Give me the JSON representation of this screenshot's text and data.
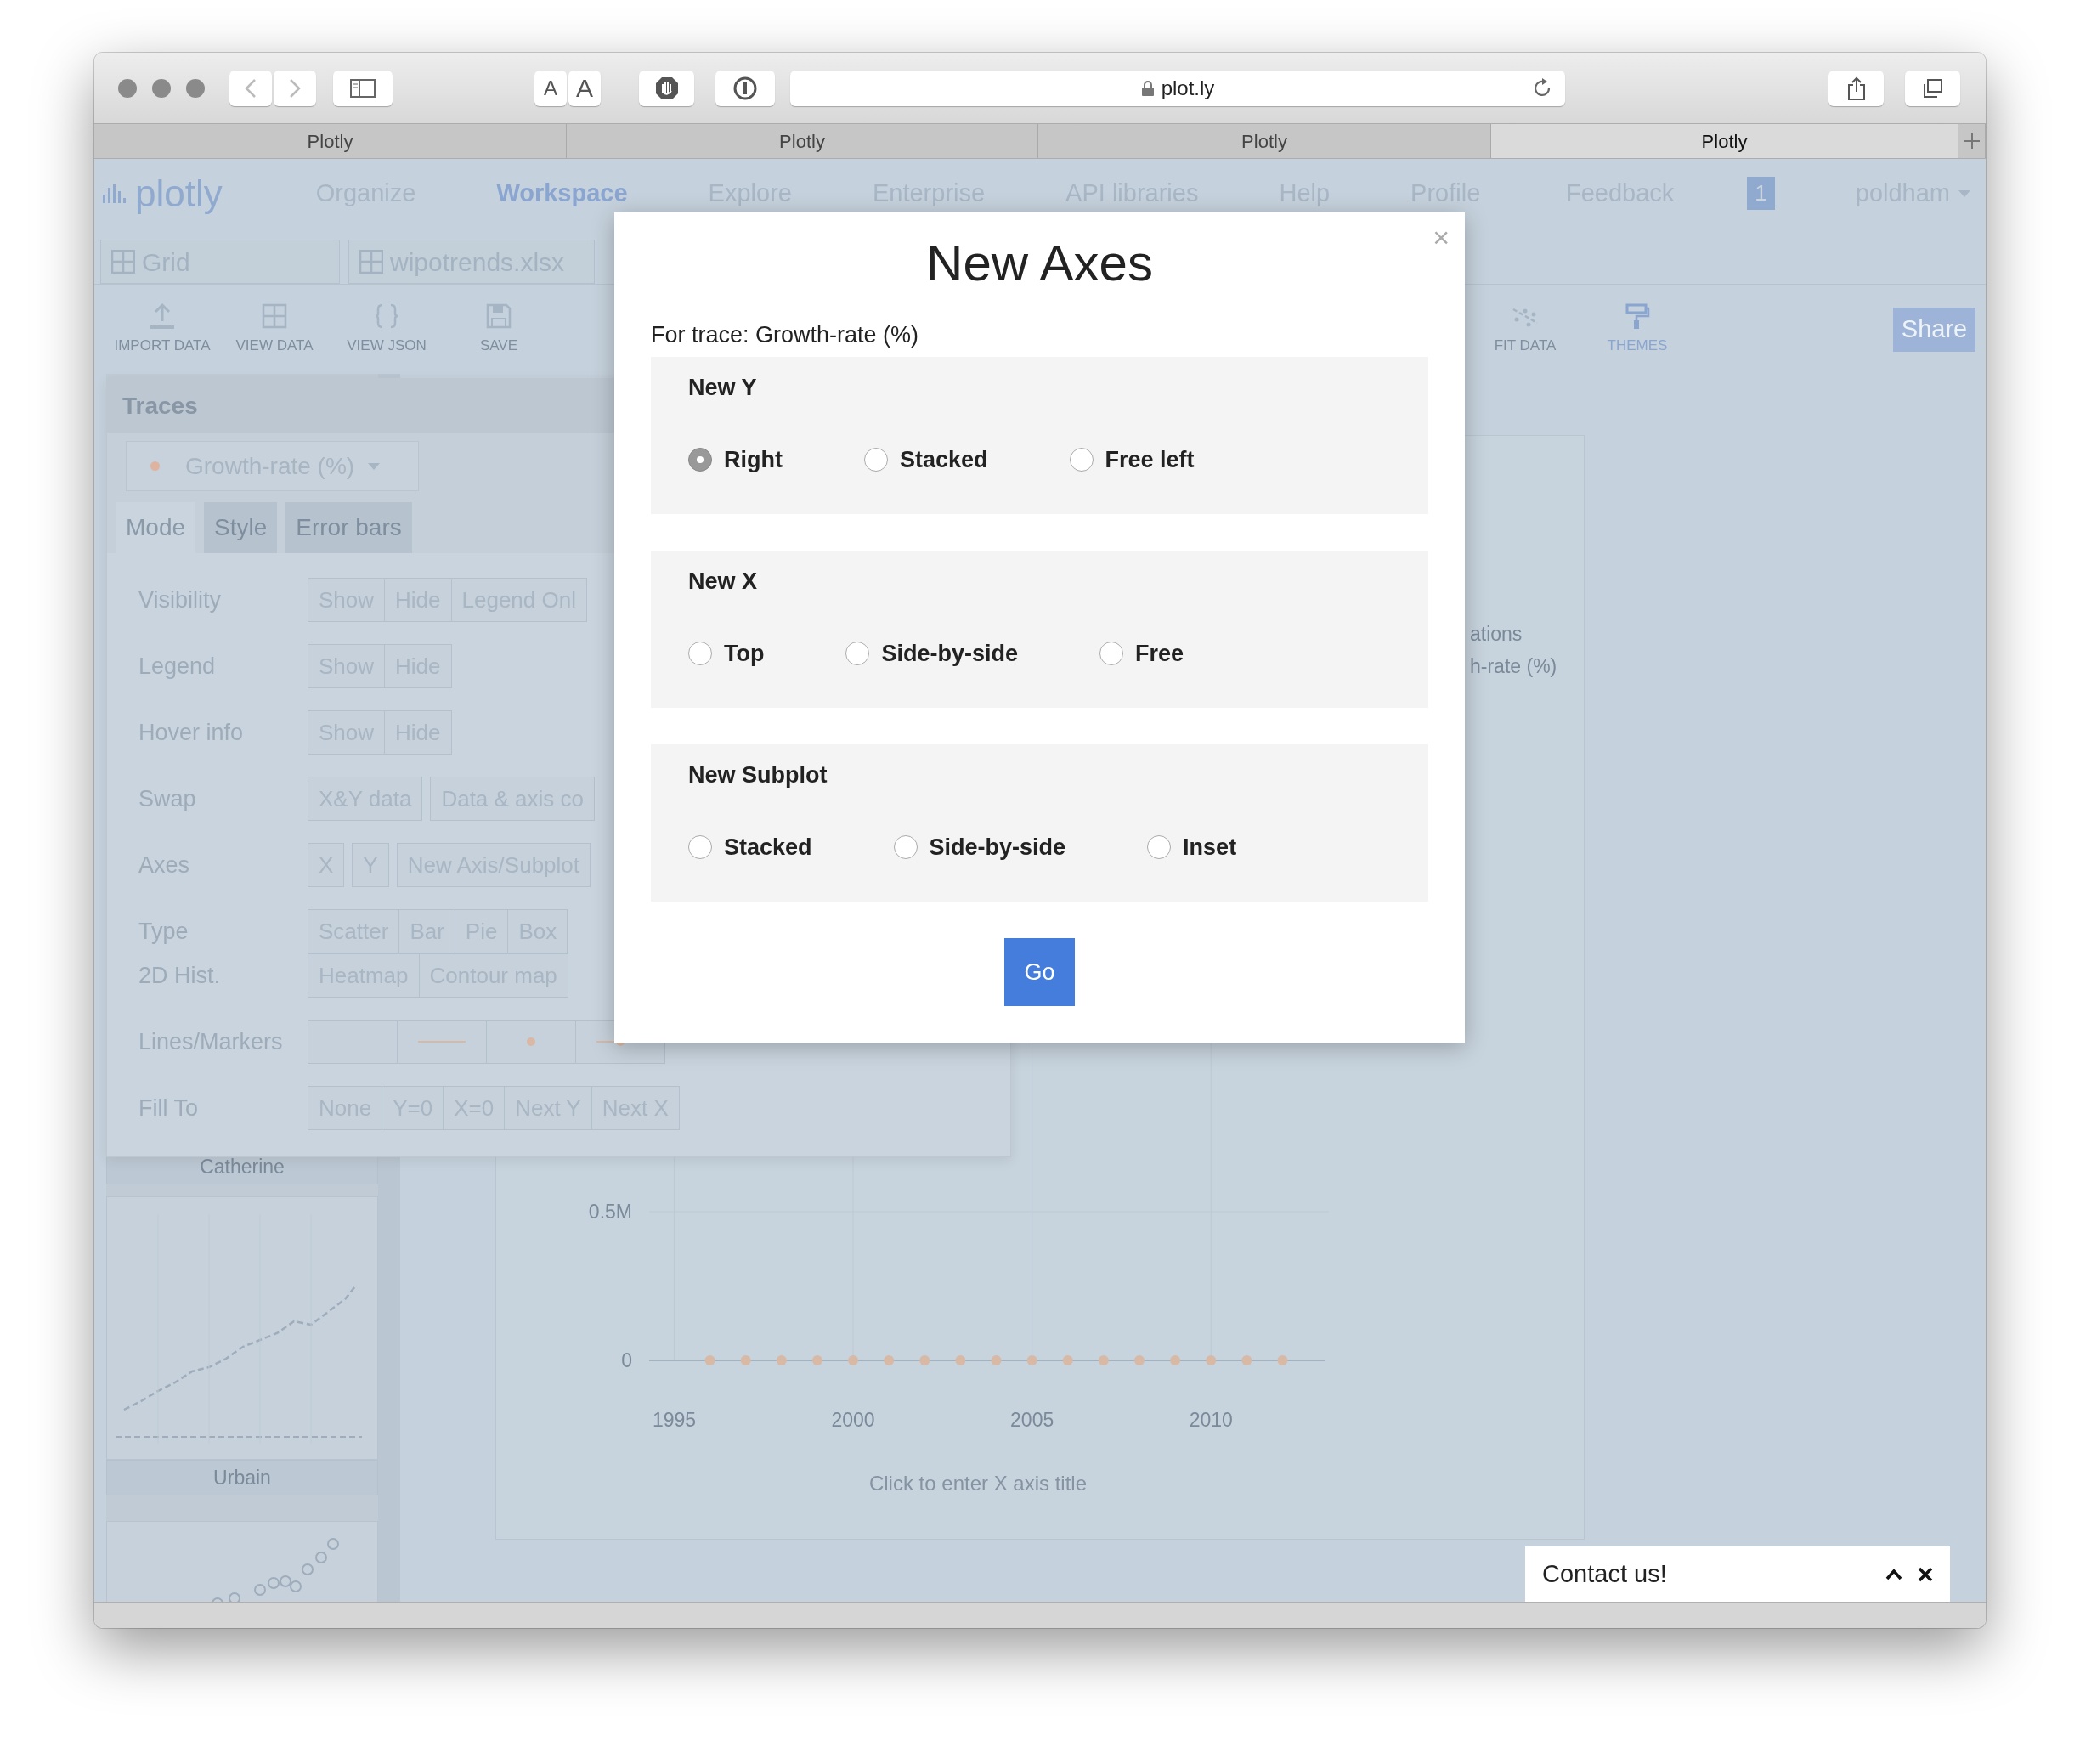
{
  "browser": {
    "text_size_buttons": [
      "A",
      "A"
    ],
    "address": "plot.ly",
    "tabs": [
      {
        "label": "Plotly",
        "selected": false
      },
      {
        "label": "Plotly",
        "selected": false
      },
      {
        "label": "Plotly",
        "selected": false
      },
      {
        "label": "Plotly",
        "selected": true
      }
    ]
  },
  "app": {
    "logo": "plotly",
    "nav": [
      {
        "label": "Organize",
        "selected": false
      },
      {
        "label": "Workspace",
        "selected": true
      },
      {
        "label": "Explore",
        "selected": false
      },
      {
        "label": "Enterprise",
        "selected": false
      },
      {
        "label": "API libraries",
        "selected": false
      },
      {
        "label": "Help",
        "selected": false
      },
      {
        "label": "Profile",
        "selected": false
      }
    ],
    "feedback": "Feedback",
    "notifications": "1",
    "user": "poldham"
  },
  "file_tabs": [
    {
      "label": "Grid"
    },
    {
      "label": "wipotrends.xlsx"
    }
  ],
  "toolbar_left": [
    {
      "label": "IMPORT DATA",
      "kind": "import",
      "selected": false
    },
    {
      "label": "VIEW DATA",
      "kind": "grid",
      "selected": false
    },
    {
      "label": "VIEW JSON",
      "kind": "json",
      "selected": false
    },
    {
      "label": "SAVE",
      "kind": "save",
      "selected": false
    }
  ],
  "toolbar_right": [
    {
      "label": "FIT DATA",
      "kind": "fit",
      "selected": false
    },
    {
      "label": "THEMES",
      "kind": "themes",
      "selected": true
    }
  ],
  "share": "Share",
  "sidebar": [
    {
      "kind": "caption",
      "label": "Catherine"
    },
    {
      "kind": "line-thumbnail"
    },
    {
      "kind": "caption",
      "label": "Urbain"
    },
    {
      "kind": "scatter-thumbnail"
    }
  ],
  "traces": {
    "title": "Traces",
    "trace": "Growth-rate (%)",
    "tabs": [
      {
        "label": "Mode",
        "selected": true
      },
      {
        "label": "Style",
        "selected": false
      },
      {
        "label": "Error bars",
        "selected": false
      }
    ],
    "rows": [
      {
        "label": "Visibility",
        "options": [
          {
            "kind": "text",
            "label": "Show"
          },
          {
            "kind": "text",
            "label": "Hide"
          },
          {
            "kind": "text",
            "label": "Legend Onl"
          }
        ]
      },
      {
        "label": "Legend",
        "options": [
          {
            "kind": "text",
            "label": "Show"
          },
          {
            "kind": "text",
            "label": "Hide"
          }
        ]
      },
      {
        "label": "Hover info",
        "options": [
          {
            "kind": "text",
            "label": "Show"
          },
          {
            "kind": "text",
            "label": "Hide"
          }
        ]
      },
      {
        "label": "Swap",
        "split": true,
        "options": [
          {
            "kind": "text",
            "label": "X&Y data"
          },
          {
            "kind": "text",
            "label": "Data & axis co"
          }
        ]
      },
      {
        "label": "Axes",
        "split": true,
        "options": [
          {
            "kind": "text",
            "label": "X"
          },
          {
            "kind": "text",
            "label": "Y"
          },
          {
            "kind": "text",
            "label": "New Axis/Subplot"
          }
        ]
      },
      {
        "label": "Type",
        "options": [
          {
            "kind": "text",
            "label": "Scatter"
          },
          {
            "kind": "text",
            "label": "Bar"
          },
          {
            "kind": "text",
            "label": "Pie"
          },
          {
            "kind": "text",
            "label": "Box"
          }
        ]
      },
      {
        "label": "2D Hist.",
        "attached": true,
        "options": [
          {
            "kind": "text",
            "label": "Heatmap"
          },
          {
            "kind": "text",
            "label": "Contour map"
          }
        ]
      },
      {
        "label": "Lines/Markers",
        "options": [
          {
            "kind": "blank"
          },
          {
            "kind": "line"
          },
          {
            "kind": "marker"
          },
          {
            "kind": "line-marker"
          }
        ]
      },
      {
        "label": "Fill To",
        "options": [
          {
            "kind": "text",
            "label": "None"
          },
          {
            "kind": "text",
            "label": "Y=0"
          },
          {
            "kind": "text",
            "label": "X=0"
          },
          {
            "kind": "text",
            "label": "Next Y"
          },
          {
            "kind": "text",
            "label": "Next X"
          }
        ]
      }
    ]
  },
  "chart": {
    "legend": [
      "ations",
      "h-rate (%)"
    ],
    "x_axis_title": "Click to enter X axis title",
    "chart_data": {
      "type": "scatter",
      "x": [
        1996,
        1997,
        1998,
        1999,
        2000,
        2001,
        2002,
        2003,
        2004,
        2005,
        2006,
        2007,
        2008,
        2009,
        2010,
        2011,
        2012
      ],
      "series": [
        {
          "color": "#d8b9a6",
          "values": [
            0,
            0,
            0,
            0,
            0,
            0,
            0,
            0,
            0,
            0,
            0,
            0,
            0,
            0,
            0,
            0,
            0
          ]
        }
      ],
      "xlim": [
        1994.3,
        2013.2
      ],
      "ylim": [
        0,
        3000000
      ],
      "grid": true,
      "xticks": [
        1995,
        2000,
        2005,
        2010
      ],
      "yticks": [
        0,
        {
          "value": 500000,
          "label": "0.5M"
        }
      ]
    }
  },
  "modal": {
    "close": "×",
    "title": "New Axes",
    "subtitle": "For trace: Growth-rate (%)",
    "groups": [
      {
        "title": "New Y",
        "options": [
          {
            "label": "Right",
            "selected": true
          },
          {
            "label": "Stacked",
            "selected": false
          },
          {
            "label": "Free left",
            "selected": false
          }
        ]
      },
      {
        "title": "New X",
        "options": [
          {
            "label": "Top",
            "selected": false
          },
          {
            "label": "Side-by-side",
            "selected": false
          },
          {
            "label": "Free",
            "selected": false
          }
        ]
      },
      {
        "title": "New Subplot",
        "options": [
          {
            "label": "Stacked",
            "selected": false
          },
          {
            "label": "Side-by-side",
            "selected": false
          },
          {
            "label": "Inset",
            "selected": false
          }
        ]
      }
    ],
    "go": "Go"
  },
  "contact": {
    "label": "Contact us!"
  }
}
